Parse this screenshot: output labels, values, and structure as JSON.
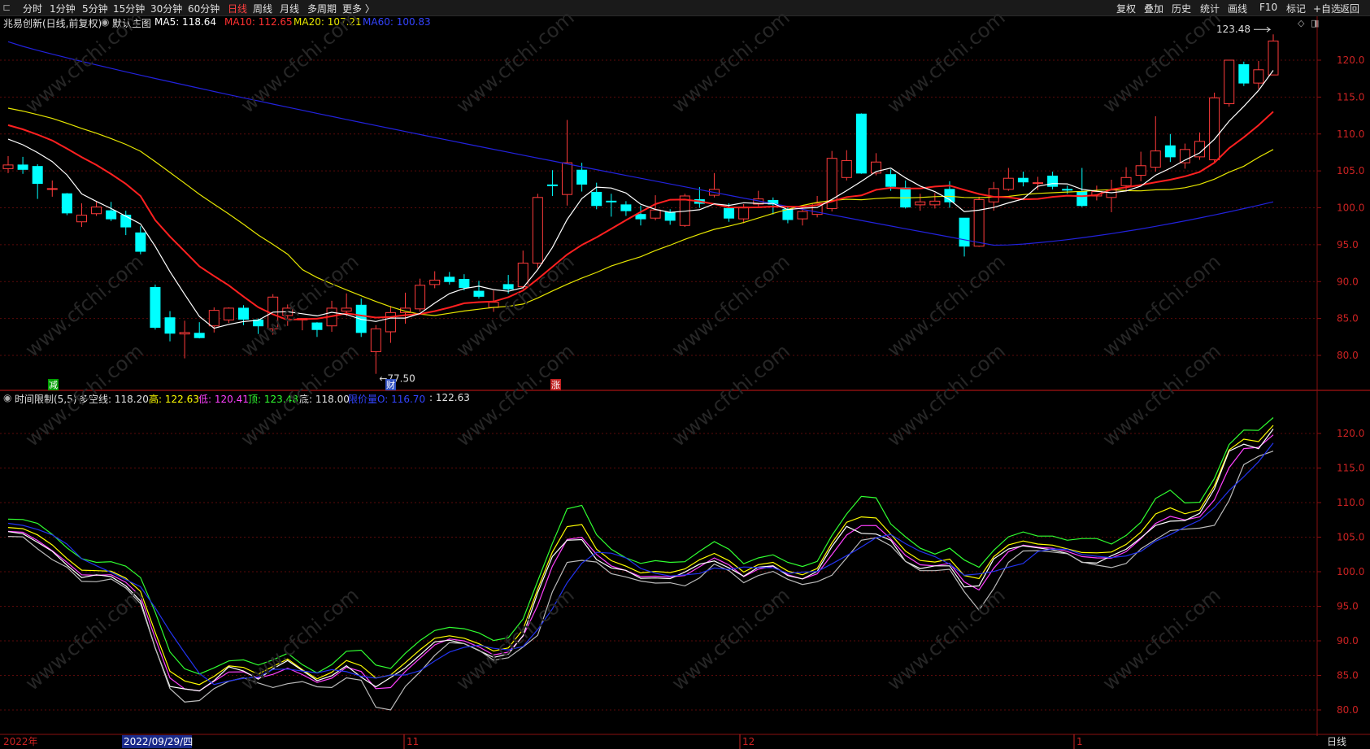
{
  "toolbar": {
    "left_items": [
      "分时",
      "1分钟",
      "5分钟",
      "15分钟",
      "30分钟",
      "60分钟",
      "日线",
      "周线",
      "月线",
      "多周期",
      "更多 〉"
    ],
    "active_index": 6,
    "right_items": [
      "复权",
      "叠加",
      "历史",
      "统计",
      "画线",
      "F10",
      "+自选",
      "返回"
    ],
    "extra_right": "标记"
  },
  "main_info": {
    "stock": "兆易创新(日线,前复权)",
    "template": "默认主图",
    "ma5_label": "MA5: 118.64",
    "ma10_label": "MA10: 112.65",
    "ma20_label": "MA20: 107.21",
    "ma60_label": "MA60: 100.83"
  },
  "sub_info": {
    "name": "时间限制(5,5)",
    "dk": "多空线: 118.20",
    "gao": "高: 122.63",
    "di": "低: 120.41",
    "ding": "顶: 123.48",
    "dibot": "底: 118.00",
    "jl": "限价量O: 116.70",
    "last": ": 122.63"
  },
  "markers": {
    "low_label": "←77.50",
    "high_label": "123.48",
    "jian": "减",
    "cai": "财",
    "zhang": "涨"
  },
  "x_axis": {
    "year": "2022年",
    "cursor_date": "2022/09/29/四",
    "m11": "11",
    "m12": "12",
    "m1": "1",
    "period": "日线"
  },
  "colors": {
    "up": "#ff3b3b",
    "down": "#00ffff",
    "ma5": "#ffffff",
    "ma10": "#ff2020",
    "ma20": "#e6e600",
    "ma60": "#2222dd"
  },
  "chart_data": {
    "type": "candlestick",
    "y_axis_main": [
      80,
      85,
      90,
      95,
      100,
      105,
      110,
      115,
      120
    ],
    "y_axis_sub": [
      80,
      85,
      90,
      95,
      100,
      105,
      110,
      115,
      120
    ],
    "candles": [
      [
        105.3,
        105.8,
        107.0,
        104.7
      ],
      [
        105.8,
        105.2,
        106.9,
        104.6
      ],
      [
        105.6,
        103.3,
        105.9,
        101.2
      ],
      [
        102.5,
        102.6,
        103.7,
        101.5
      ],
      [
        101.9,
        99.3,
        102.0,
        99.0
      ],
      [
        98.1,
        99.0,
        100.6,
        97.4
      ],
      [
        99.2,
        100.1,
        100.9,
        98.9
      ],
      [
        99.6,
        98.5,
        100.8,
        98.2
      ],
      [
        99.0,
        97.4,
        99.6,
        96.3
      ],
      [
        96.6,
        94.1,
        97.5,
        93.7
      ],
      [
        89.2,
        83.8,
        89.6,
        83.5
      ],
      [
        85.1,
        83.0,
        86.0,
        81.9
      ],
      [
        82.9,
        83.1,
        84.7,
        79.6
      ],
      [
        83.0,
        82.4,
        84.5,
        82.3
      ],
      [
        84.0,
        86.1,
        86.5,
        83.1
      ],
      [
        84.8,
        86.4,
        86.5,
        84.4
      ],
      [
        86.4,
        84.9,
        86.8,
        84.1
      ],
      [
        84.8,
        84.0,
        85.0,
        82.9
      ],
      [
        83.6,
        87.9,
        88.3,
        82.8
      ],
      [
        85.4,
        86.4,
        86.9,
        84.0
      ],
      [
        84.8,
        85.0,
        85.0,
        83.4
      ],
      [
        84.4,
        83.5,
        84.5,
        82.5
      ],
      [
        84.0,
        86.4,
        87.4,
        83.2
      ],
      [
        86.0,
        86.4,
        88.4,
        85.3
      ],
      [
        86.8,
        83.1,
        87.7,
        82.5
      ],
      [
        80.5,
        83.6,
        84.1,
        77.5
      ],
      [
        83.2,
        85.8,
        86.7,
        81.7
      ],
      [
        85.8,
        86.4,
        88.5,
        84.3
      ],
      [
        86.3,
        89.5,
        90.4,
        85.9
      ],
      [
        89.6,
        90.2,
        91.4,
        89.1
      ],
      [
        90.6,
        90.0,
        91.3,
        89.6
      ],
      [
        90.3,
        89.2,
        91.0,
        88.8
      ],
      [
        88.7,
        88.0,
        90.1,
        87.7
      ],
      [
        86.5,
        87.2,
        88.8,
        85.9
      ],
      [
        89.6,
        89.0,
        90.9,
        88.4
      ],
      [
        89.3,
        92.5,
        94.2,
        89.0
      ],
      [
        92.5,
        101.4,
        101.9,
        91.8
      ],
      [
        103.1,
        103.0,
        105.1,
        101.6
      ],
      [
        101.8,
        106.1,
        111.9,
        100.3
      ],
      [
        105.1,
        103.2,
        106.1,
        102.2
      ],
      [
        102.1,
        100.3,
        103.4,
        99.8
      ],
      [
        100.9,
        100.8,
        101.9,
        98.8
      ],
      [
        100.4,
        99.6,
        100.9,
        98.9
      ],
      [
        99.1,
        98.5,
        100.3,
        97.6
      ],
      [
        98.6,
        99.7,
        101.7,
        98.3
      ],
      [
        99.4,
        98.3,
        99.8,
        97.7
      ],
      [
        97.6,
        101.6,
        101.9,
        97.4
      ],
      [
        101.1,
        100.6,
        102.8,
        100.0
      ],
      [
        101.7,
        102.5,
        104.7,
        101.4
      ],
      [
        99.9,
        98.6,
        100.6,
        98.1
      ],
      [
        98.5,
        100.1,
        100.5,
        97.9
      ],
      [
        100.5,
        101.2,
        102.3,
        100.2
      ],
      [
        101.0,
        100.5,
        101.4,
        99.1
      ],
      [
        99.8,
        98.4,
        100.1,
        97.9
      ],
      [
        98.5,
        99.5,
        100.2,
        97.6
      ],
      [
        99.1,
        100.6,
        101.6,
        98.7
      ],
      [
        99.9,
        106.7,
        107.7,
        99.5
      ],
      [
        104.1,
        106.4,
        107.8,
        103.7
      ],
      [
        112.7,
        104.7,
        112.8,
        104.6
      ],
      [
        104.7,
        106.2,
        107.4,
        104.4
      ],
      [
        104.5,
        102.9,
        105.2,
        102.3
      ],
      [
        102.7,
        100.1,
        103.7,
        99.9
      ],
      [
        100.4,
        100.8,
        101.9,
        99.6
      ],
      [
        100.4,
        100.9,
        102.0,
        99.9
      ],
      [
        102.5,
        100.8,
        103.6,
        100.0
      ],
      [
        98.6,
        94.8,
        98.6,
        93.4
      ],
      [
        94.8,
        101.1,
        101.5,
        94.7
      ],
      [
        100.8,
        102.6,
        103.5,
        99.6
      ],
      [
        102.5,
        104.0,
        105.4,
        102.3
      ],
      [
        104.0,
        103.5,
        104.9,
        102.9
      ],
      [
        103.4,
        103.4,
        104.2,
        102.4
      ],
      [
        104.3,
        102.9,
        104.9,
        102.5
      ],
      [
        102.5,
        102.4,
        103.0,
        101.9
      ],
      [
        102.2,
        100.3,
        105.4,
        100.1
      ],
      [
        101.6,
        102.2,
        103.0,
        101.0
      ],
      [
        101.4,
        102.4,
        103.8,
        99.4
      ],
      [
        103.0,
        104.1,
        105.5,
        102.2
      ],
      [
        104.4,
        105.7,
        107.6,
        103.6
      ],
      [
        105.5,
        107.7,
        112.4,
        104.9
      ],
      [
        108.4,
        106.9,
        110.0,
        106.2
      ],
      [
        106.1,
        107.9,
        108.7,
        105.3
      ],
      [
        106.9,
        109.0,
        110.2,
        106.5
      ],
      [
        106.5,
        114.9,
        115.6,
        106.1
      ],
      [
        114.1,
        120.0,
        120.0,
        113.7
      ],
      [
        119.4,
        116.9,
        119.8,
        116.5
      ],
      [
        116.9,
        118.7,
        119.9,
        116.1
      ],
      [
        118.0,
        122.6,
        123.5,
        118.0
      ]
    ],
    "sub_series_note": "multi-line indicator tracking price: 高, 低, 顶, 底, 限价量, 多空线"
  }
}
